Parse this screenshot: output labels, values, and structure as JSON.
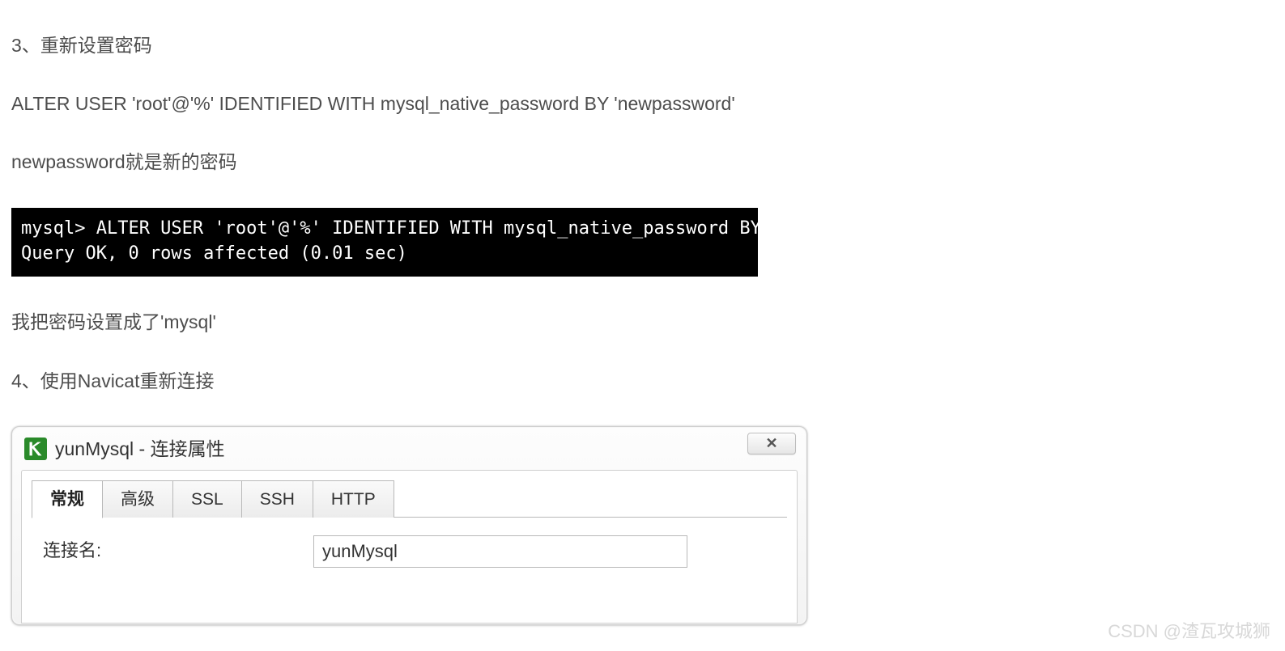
{
  "article": {
    "p1": "3、重新设置密码",
    "p2": "ALTER USER 'root'@'%' IDENTIFIED WITH mysql_native_password BY 'newpassword'",
    "p3": "newpassword就是新的密码",
    "terminal": "mysql> ALTER USER 'root'@'%' IDENTIFIED WITH mysql_native_password BY 'mysql';\nQuery OK, 0 rows affected (0.01 sec)",
    "p4": "我把密码设置成了'mysql'",
    "p5": "4、使用Navicat重新连接"
  },
  "dialog": {
    "title": "yunMysql - 连接属性",
    "close_glyph": "✕",
    "tabs": {
      "general": "常规",
      "advanced": "高级",
      "ssl": "SSL",
      "ssh": "SSH",
      "http": "HTTP"
    },
    "form": {
      "conn_name_label": "连接名:",
      "conn_name_value": "yunMysql"
    }
  },
  "watermark": "CSDN @渣瓦攻城狮"
}
